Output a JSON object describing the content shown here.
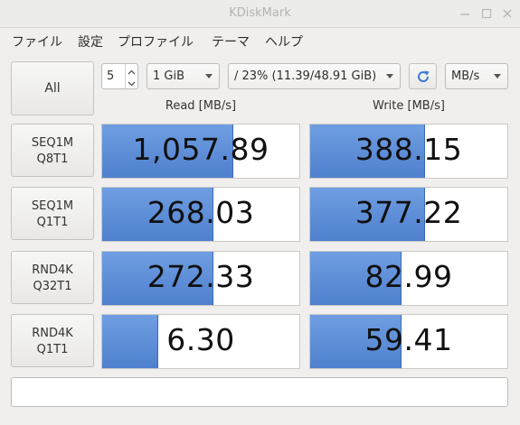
{
  "window": {
    "title": "KDiskMark"
  },
  "menu": [
    "ファイル",
    "設定",
    "プロファイル",
    "テーマ",
    "ヘルプ"
  ],
  "toolbar": {
    "all_label": "All",
    "loops": "5",
    "size": "1 GiB",
    "drive": "/ 23% (11.39/48.91 GiB)",
    "unit": "MB/s",
    "refresh_icon": "refresh-icon"
  },
  "headers": {
    "read": "Read [MB/s]",
    "write": "Write [MB/s]"
  },
  "rows": [
    {
      "line1": "SEQ1M",
      "line2": "Q8T1",
      "read": "1,057.89",
      "write": "388.15",
      "read_fill": 0.66,
      "write_fill": 0.58
    },
    {
      "line1": "SEQ1M",
      "line2": "Q1T1",
      "read": "268.03",
      "write": "377.22",
      "read_fill": 0.56,
      "write_fill": 0.58
    },
    {
      "line1": "RND4K",
      "line2": "Q32T1",
      "read": "272.33",
      "write": "82.99",
      "read_fill": 0.56,
      "write_fill": 0.46
    },
    {
      "line1": "RND4K",
      "line2": "Q1T1",
      "read": "6.30",
      "write": "59.41",
      "read_fill": 0.28,
      "write_fill": 0.46
    }
  ],
  "comment": ""
}
